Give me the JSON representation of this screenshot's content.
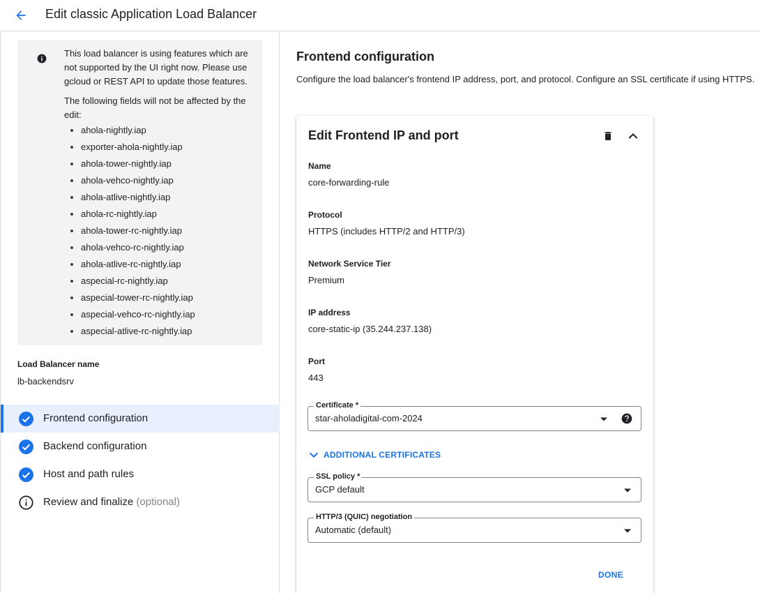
{
  "header": {
    "title": "Edit classic Application Load Balancer"
  },
  "info_box": {
    "paragraph1": "This load balancer is using features which are not supported by the UI right now. Please use gcloud or REST API to update those features.",
    "paragraph2": "The following fields will not be affected by the edit:",
    "items": [
      "ahola-nightly.iap",
      "exporter-ahola-nightly.iap",
      "ahola-tower-nightly.iap",
      "ahola-vehco-nightly.iap",
      "ahola-atlive-nightly.iap",
      "ahola-rc-nightly.iap",
      "ahola-tower-rc-nightly.iap",
      "ahola-vehco-rc-nightly.iap",
      "ahola-atlive-rc-nightly.iap",
      "aspecial-rc-nightly.iap",
      "aspecial-tower-rc-nightly.iap",
      "aspecial-vehco-rc-nightly.iap",
      "aspecial-atlive-rc-nightly.iap"
    ]
  },
  "load_balancer": {
    "label": "Load Balancer name",
    "value": "lb-backendsrv"
  },
  "steps": [
    {
      "label": "Frontend configuration",
      "optional": "",
      "status": "complete",
      "active": true
    },
    {
      "label": "Backend configuration",
      "optional": "",
      "status": "complete",
      "active": false
    },
    {
      "label": "Host and path rules",
      "optional": "",
      "status": "complete",
      "active": false
    },
    {
      "label": "Review and finalize",
      "optional": "(optional)",
      "status": "info",
      "active": false
    }
  ],
  "main": {
    "title": "Frontend configuration",
    "description": "Configure the load balancer's frontend IP address, port, and protocol. Configure an SSL certificate if using HTTPS."
  },
  "card": {
    "title": "Edit Frontend IP and port",
    "fields": [
      {
        "label": "Name",
        "value": "core-forwarding-rule"
      },
      {
        "label": "Protocol",
        "value": "HTTPS (includes HTTP/2 and HTTP/3)"
      },
      {
        "label": "Network Service Tier",
        "value": "Premium"
      },
      {
        "label": "IP address",
        "value": "core-static-ip (35.244.237.138)"
      },
      {
        "label": "Port",
        "value": "443"
      }
    ],
    "certificate": {
      "label": "Certificate *",
      "value": "star-aholadigital-com-2024"
    },
    "additional_certificates": "ADDITIONAL CERTIFICATES",
    "ssl_policy": {
      "label": "SSL policy *",
      "value": "GCP default"
    },
    "quic": {
      "label": "HTTP/3 (QUIC) negotiation",
      "value": "Automatic (default)"
    },
    "done": "DONE"
  },
  "colors": {
    "accent": "#1a73e8",
    "text": "#202124",
    "info_bg": "#f1f3f4",
    "active_bg": "#e8f0fe",
    "border": "#dadce0"
  },
  "icons": {
    "back": "arrow-back-icon",
    "info": "info-filled-icon",
    "step_complete": "check-circle-icon",
    "step_info": "info-outline-icon",
    "delete": "trash-icon",
    "collapse": "chevron-up-icon",
    "dropdown": "caret-down-icon",
    "help": "help-icon",
    "expand": "chevron-down-icon"
  }
}
